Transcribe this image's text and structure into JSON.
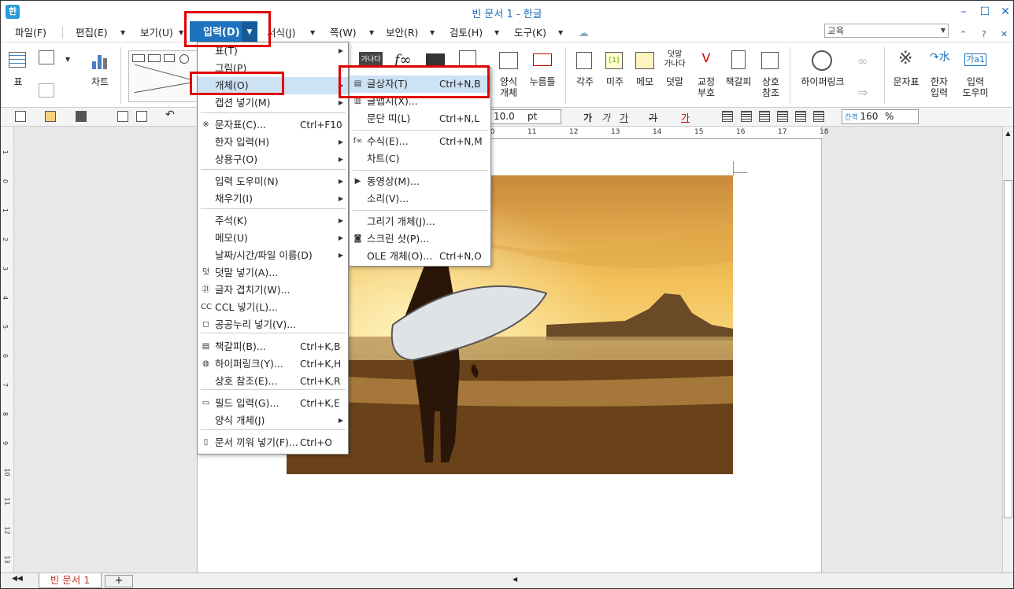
{
  "window": {
    "title": "빈 문서 1 - 한글",
    "app_icon": "한"
  },
  "menubar": {
    "items": [
      "파일(F)",
      "편집(E)",
      "보기(U)",
      "입력(D)",
      "서식(J)",
      "쪽(W)",
      "보안(R)",
      "검토(H)",
      "도구(K)"
    ],
    "search_value": "교육"
  },
  "ribbon": {
    "table": "표",
    "chart": "차트",
    "form_object": "양식\n개체",
    "push_button": "누름틀",
    "footnote": "각주",
    "endnote": "미주",
    "memo": "메모",
    "overlay": "덧말",
    "proofread": "교정\n부호",
    "bookmark": "책갈피",
    "cross_ref": "상호\n참조",
    "hyperlink": "하이퍼링크",
    "char_map": "문자표",
    "hanja_input": "한자\n입력",
    "input_helper": "입력\n도우미",
    "overlay_icon_text": "덧말\n가나다",
    "input_icon_text": "가a1"
  },
  "formatbar": {
    "font_size": "10.0",
    "font_unit": "pt",
    "line_spacing": "160",
    "line_unit": "%",
    "bold": "가",
    "italic": "가",
    "underline": "가",
    "strike": "가",
    "color": "가"
  },
  "ruler_marks": [
    "10",
    "11",
    "12",
    "13",
    "14",
    "15",
    "16",
    "17",
    "18"
  ],
  "vruler_marks": [
    "1",
    "0",
    "1",
    "2",
    "3",
    "4",
    "5",
    "6",
    "7",
    "8",
    "9",
    "10",
    "11",
    "12",
    "13"
  ],
  "status": {
    "doc_tab": "빈 문서 1",
    "add_tab": "+"
  },
  "input_menu": {
    "items": [
      {
        "label": "표(T)",
        "shortcut": "",
        "sub": true,
        "icon": ""
      },
      {
        "label": "그림(P)",
        "shortcut": "",
        "sub": false,
        "icon": ""
      },
      {
        "label": "개체(O)",
        "shortcut": "",
        "sub": true,
        "icon": ""
      },
      {
        "label": "캡션 넣기(M)",
        "shortcut": "",
        "sub": true,
        "icon": ""
      },
      {
        "label": "문자표(C)...",
        "shortcut": "Ctrl+F10",
        "sub": false,
        "icon": "※"
      },
      {
        "label": "한자 입력(H)",
        "shortcut": "",
        "sub": true,
        "icon": ""
      },
      {
        "label": "상용구(O)",
        "shortcut": "",
        "sub": true,
        "icon": ""
      },
      {
        "label": "입력 도우미(N)",
        "shortcut": "",
        "sub": true,
        "icon": ""
      },
      {
        "label": "채우기(I)",
        "shortcut": "",
        "sub": true,
        "icon": ""
      },
      {
        "label": "주석(K)",
        "shortcut": "",
        "sub": true,
        "icon": ""
      },
      {
        "label": "메모(U)",
        "shortcut": "",
        "sub": true,
        "icon": ""
      },
      {
        "label": "날짜/시간/파일 이름(D)",
        "shortcut": "",
        "sub": true,
        "icon": ""
      },
      {
        "label": "덧말 넣기(A)...",
        "shortcut": "",
        "sub": false,
        "icon": "덧"
      },
      {
        "label": "글자 겹치기(W)...",
        "shortcut": "",
        "sub": false,
        "icon": "㉑"
      },
      {
        "label": "CCL 넣기(L)...",
        "shortcut": "",
        "sub": false,
        "icon": "CC"
      },
      {
        "label": "공공누리 넣기(V)...",
        "shortcut": "",
        "sub": false,
        "icon": "◻"
      },
      {
        "label": "책갈피(B)...",
        "shortcut": "Ctrl+K,B",
        "sub": false,
        "icon": "▤"
      },
      {
        "label": "하이퍼링크(Y)...",
        "shortcut": "Ctrl+K,H",
        "sub": false,
        "icon": "◍"
      },
      {
        "label": "상호 참조(E)...",
        "shortcut": "Ctrl+K,R",
        "sub": false,
        "icon": ""
      },
      {
        "label": "필드 입력(G)...",
        "shortcut": "Ctrl+K,E",
        "sub": false,
        "icon": "▭"
      },
      {
        "label": "양식 개체(J)",
        "shortcut": "",
        "sub": true,
        "icon": ""
      },
      {
        "label": "문서 끼워 넣기(F)...",
        "shortcut": "Ctrl+O",
        "sub": false,
        "icon": "▯"
      }
    ]
  },
  "object_submenu": {
    "items": [
      {
        "label": "글상자(T)",
        "shortcut": "Ctrl+N,B",
        "icon": "▤"
      },
      {
        "label": "글맵시(X)...",
        "shortcut": "",
        "icon": "▥"
      },
      {
        "label": "문단 띠(L)",
        "shortcut": "Ctrl+N,L",
        "icon": ""
      },
      {
        "label": "수식(E)...",
        "shortcut": "Ctrl+N,M",
        "icon": "f∞"
      },
      {
        "label": "차트(C)",
        "shortcut": "",
        "icon": ""
      },
      {
        "label": "동영상(M)...",
        "shortcut": "",
        "icon": "▶"
      },
      {
        "label": "소리(V)...",
        "shortcut": "",
        "icon": ""
      },
      {
        "label": "그리기 개체(J)...",
        "shortcut": "",
        "icon": ""
      },
      {
        "label": "스크린 샷(P)...",
        "shortcut": "",
        "icon": "◙"
      },
      {
        "label": "OLE 개체(O)...",
        "shortcut": "Ctrl+N,O",
        "icon": ""
      }
    ]
  },
  "colors": {
    "accent": "#1e73be",
    "highlight": "#e00000",
    "title": "#1e6bb8"
  }
}
